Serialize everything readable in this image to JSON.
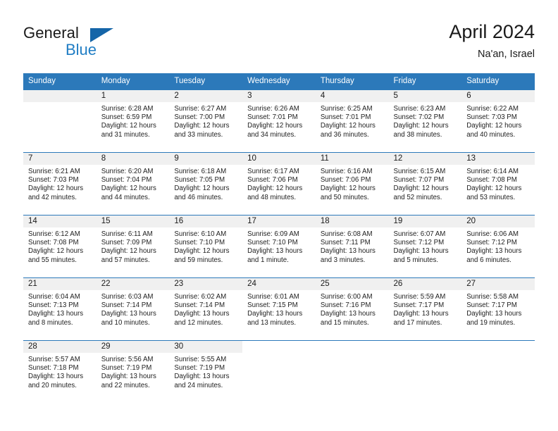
{
  "brand": {
    "word_one": "General",
    "word_two": "Blue",
    "triangle_icon": "blue-triangle-logo-icon"
  },
  "header": {
    "title": "April 2024",
    "location": "Na'an, Israel"
  },
  "colors": {
    "header_blue": "#2c79ba",
    "brand_blue": "#1f7dc4",
    "daynum_band": "#f0f0f0",
    "text": "#1a1a1a"
  },
  "weekday_headers": [
    "Sunday",
    "Monday",
    "Tuesday",
    "Wednesday",
    "Thursday",
    "Friday",
    "Saturday"
  ],
  "weeks": [
    [
      {
        "day": "",
        "sunrise": "",
        "sunset": "",
        "daylight_1": "",
        "daylight_2": ""
      },
      {
        "day": "1",
        "sunrise": "Sunrise: 6:28 AM",
        "sunset": "Sunset: 6:59 PM",
        "daylight_1": "Daylight: 12 hours",
        "daylight_2": "and 31 minutes."
      },
      {
        "day": "2",
        "sunrise": "Sunrise: 6:27 AM",
        "sunset": "Sunset: 7:00 PM",
        "daylight_1": "Daylight: 12 hours",
        "daylight_2": "and 33 minutes."
      },
      {
        "day": "3",
        "sunrise": "Sunrise: 6:26 AM",
        "sunset": "Sunset: 7:01 PM",
        "daylight_1": "Daylight: 12 hours",
        "daylight_2": "and 34 minutes."
      },
      {
        "day": "4",
        "sunrise": "Sunrise: 6:25 AM",
        "sunset": "Sunset: 7:01 PM",
        "daylight_1": "Daylight: 12 hours",
        "daylight_2": "and 36 minutes."
      },
      {
        "day": "5",
        "sunrise": "Sunrise: 6:23 AM",
        "sunset": "Sunset: 7:02 PM",
        "daylight_1": "Daylight: 12 hours",
        "daylight_2": "and 38 minutes."
      },
      {
        "day": "6",
        "sunrise": "Sunrise: 6:22 AM",
        "sunset": "Sunset: 7:03 PM",
        "daylight_1": "Daylight: 12 hours",
        "daylight_2": "and 40 minutes."
      }
    ],
    [
      {
        "day": "7",
        "sunrise": "Sunrise: 6:21 AM",
        "sunset": "Sunset: 7:03 PM",
        "daylight_1": "Daylight: 12 hours",
        "daylight_2": "and 42 minutes."
      },
      {
        "day": "8",
        "sunrise": "Sunrise: 6:20 AM",
        "sunset": "Sunset: 7:04 PM",
        "daylight_1": "Daylight: 12 hours",
        "daylight_2": "and 44 minutes."
      },
      {
        "day": "9",
        "sunrise": "Sunrise: 6:18 AM",
        "sunset": "Sunset: 7:05 PM",
        "daylight_1": "Daylight: 12 hours",
        "daylight_2": "and 46 minutes."
      },
      {
        "day": "10",
        "sunrise": "Sunrise: 6:17 AM",
        "sunset": "Sunset: 7:06 PM",
        "daylight_1": "Daylight: 12 hours",
        "daylight_2": "and 48 minutes."
      },
      {
        "day": "11",
        "sunrise": "Sunrise: 6:16 AM",
        "sunset": "Sunset: 7:06 PM",
        "daylight_1": "Daylight: 12 hours",
        "daylight_2": "and 50 minutes."
      },
      {
        "day": "12",
        "sunrise": "Sunrise: 6:15 AM",
        "sunset": "Sunset: 7:07 PM",
        "daylight_1": "Daylight: 12 hours",
        "daylight_2": "and 52 minutes."
      },
      {
        "day": "13",
        "sunrise": "Sunrise: 6:14 AM",
        "sunset": "Sunset: 7:08 PM",
        "daylight_1": "Daylight: 12 hours",
        "daylight_2": "and 53 minutes."
      }
    ],
    [
      {
        "day": "14",
        "sunrise": "Sunrise: 6:12 AM",
        "sunset": "Sunset: 7:08 PM",
        "daylight_1": "Daylight: 12 hours",
        "daylight_2": "and 55 minutes."
      },
      {
        "day": "15",
        "sunrise": "Sunrise: 6:11 AM",
        "sunset": "Sunset: 7:09 PM",
        "daylight_1": "Daylight: 12 hours",
        "daylight_2": "and 57 minutes."
      },
      {
        "day": "16",
        "sunrise": "Sunrise: 6:10 AM",
        "sunset": "Sunset: 7:10 PM",
        "daylight_1": "Daylight: 12 hours",
        "daylight_2": "and 59 minutes."
      },
      {
        "day": "17",
        "sunrise": "Sunrise: 6:09 AM",
        "sunset": "Sunset: 7:10 PM",
        "daylight_1": "Daylight: 13 hours",
        "daylight_2": "and 1 minute."
      },
      {
        "day": "18",
        "sunrise": "Sunrise: 6:08 AM",
        "sunset": "Sunset: 7:11 PM",
        "daylight_1": "Daylight: 13 hours",
        "daylight_2": "and 3 minutes."
      },
      {
        "day": "19",
        "sunrise": "Sunrise: 6:07 AM",
        "sunset": "Sunset: 7:12 PM",
        "daylight_1": "Daylight: 13 hours",
        "daylight_2": "and 5 minutes."
      },
      {
        "day": "20",
        "sunrise": "Sunrise: 6:06 AM",
        "sunset": "Sunset: 7:12 PM",
        "daylight_1": "Daylight: 13 hours",
        "daylight_2": "and 6 minutes."
      }
    ],
    [
      {
        "day": "21",
        "sunrise": "Sunrise: 6:04 AM",
        "sunset": "Sunset: 7:13 PM",
        "daylight_1": "Daylight: 13 hours",
        "daylight_2": "and 8 minutes."
      },
      {
        "day": "22",
        "sunrise": "Sunrise: 6:03 AM",
        "sunset": "Sunset: 7:14 PM",
        "daylight_1": "Daylight: 13 hours",
        "daylight_2": "and 10 minutes."
      },
      {
        "day": "23",
        "sunrise": "Sunrise: 6:02 AM",
        "sunset": "Sunset: 7:14 PM",
        "daylight_1": "Daylight: 13 hours",
        "daylight_2": "and 12 minutes."
      },
      {
        "day": "24",
        "sunrise": "Sunrise: 6:01 AM",
        "sunset": "Sunset: 7:15 PM",
        "daylight_1": "Daylight: 13 hours",
        "daylight_2": "and 13 minutes."
      },
      {
        "day": "25",
        "sunrise": "Sunrise: 6:00 AM",
        "sunset": "Sunset: 7:16 PM",
        "daylight_1": "Daylight: 13 hours",
        "daylight_2": "and 15 minutes."
      },
      {
        "day": "26",
        "sunrise": "Sunrise: 5:59 AM",
        "sunset": "Sunset: 7:17 PM",
        "daylight_1": "Daylight: 13 hours",
        "daylight_2": "and 17 minutes."
      },
      {
        "day": "27",
        "sunrise": "Sunrise: 5:58 AM",
        "sunset": "Sunset: 7:17 PM",
        "daylight_1": "Daylight: 13 hours",
        "daylight_2": "and 19 minutes."
      }
    ],
    [
      {
        "day": "28",
        "sunrise": "Sunrise: 5:57 AM",
        "sunset": "Sunset: 7:18 PM",
        "daylight_1": "Daylight: 13 hours",
        "daylight_2": "and 20 minutes."
      },
      {
        "day": "29",
        "sunrise": "Sunrise: 5:56 AM",
        "sunset": "Sunset: 7:19 PM",
        "daylight_1": "Daylight: 13 hours",
        "daylight_2": "and 22 minutes."
      },
      {
        "day": "30",
        "sunrise": "Sunrise: 5:55 AM",
        "sunset": "Sunset: 7:19 PM",
        "daylight_1": "Daylight: 13 hours",
        "daylight_2": "and 24 minutes."
      },
      {
        "day": "",
        "sunrise": "",
        "sunset": "",
        "daylight_1": "",
        "daylight_2": ""
      },
      {
        "day": "",
        "sunrise": "",
        "sunset": "",
        "daylight_1": "",
        "daylight_2": ""
      },
      {
        "day": "",
        "sunrise": "",
        "sunset": "",
        "daylight_1": "",
        "daylight_2": ""
      },
      {
        "day": "",
        "sunrise": "",
        "sunset": "",
        "daylight_1": "",
        "daylight_2": ""
      }
    ]
  ]
}
